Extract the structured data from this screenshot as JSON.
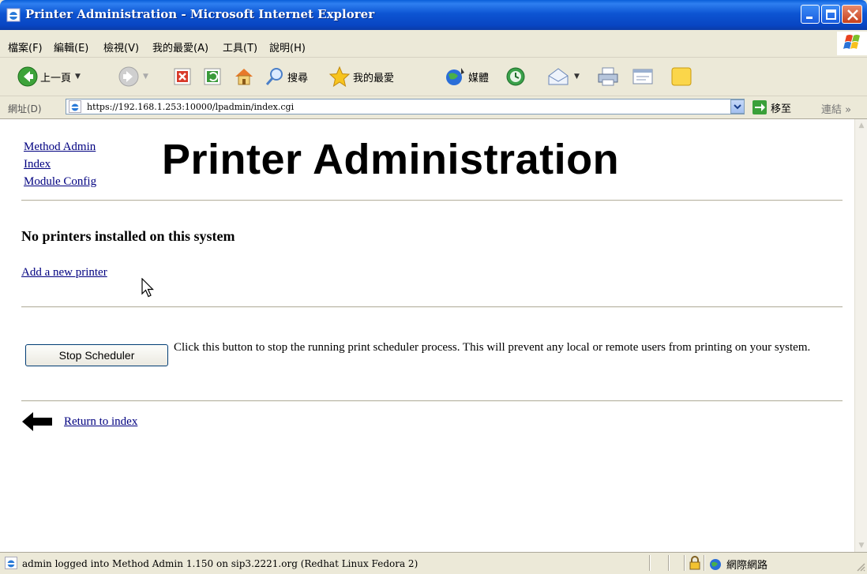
{
  "window": {
    "title": "Printer Administration - Microsoft Internet Explorer"
  },
  "menu": {
    "items": [
      "檔案(F)",
      "編輯(E)",
      "檢視(V)",
      "我的最愛(A)",
      "工具(T)",
      "說明(H)"
    ]
  },
  "toolbar": {
    "back_label": "上一頁",
    "search_label": "搜尋",
    "favorites_label": "我的最愛",
    "media_label": "媒體",
    "icons": [
      "back-icon",
      "forward-icon",
      "stop-icon",
      "refresh-icon",
      "home-icon",
      "search-icon",
      "favorites-star-icon",
      "media-icon",
      "history-icon",
      "mail-icon",
      "print-icon",
      "edit-icon",
      "messenger-icon"
    ]
  },
  "address_bar": {
    "label": "網址(D)",
    "url": "https://192.168.1.253:10000/lpadmin/index.cgi",
    "go_label": "移至",
    "links_label": "連結",
    "more_chevron": "»"
  },
  "page": {
    "nav_links": [
      "Method Admin",
      "Index",
      "Module Config"
    ],
    "title": "Printer Administration",
    "no_printers_heading": "No printers installed on this system",
    "add_printer_link": "Add a new printer",
    "stop_button_label": "Stop Scheduler",
    "stop_description": "Click this button to stop the running print scheduler process. This will prevent any local or remote users from printing on your system.",
    "return_link": "Return to index"
  },
  "status_bar": {
    "text": "admin logged into Method Admin 1.150 on sip3.2221.org (Redhat Linux Fedora 2)",
    "zone_label": "網際網路"
  },
  "colors": {
    "titlebar_blue": "#0d55d3",
    "link": "#000080",
    "chrome": "#ece9d8"
  }
}
